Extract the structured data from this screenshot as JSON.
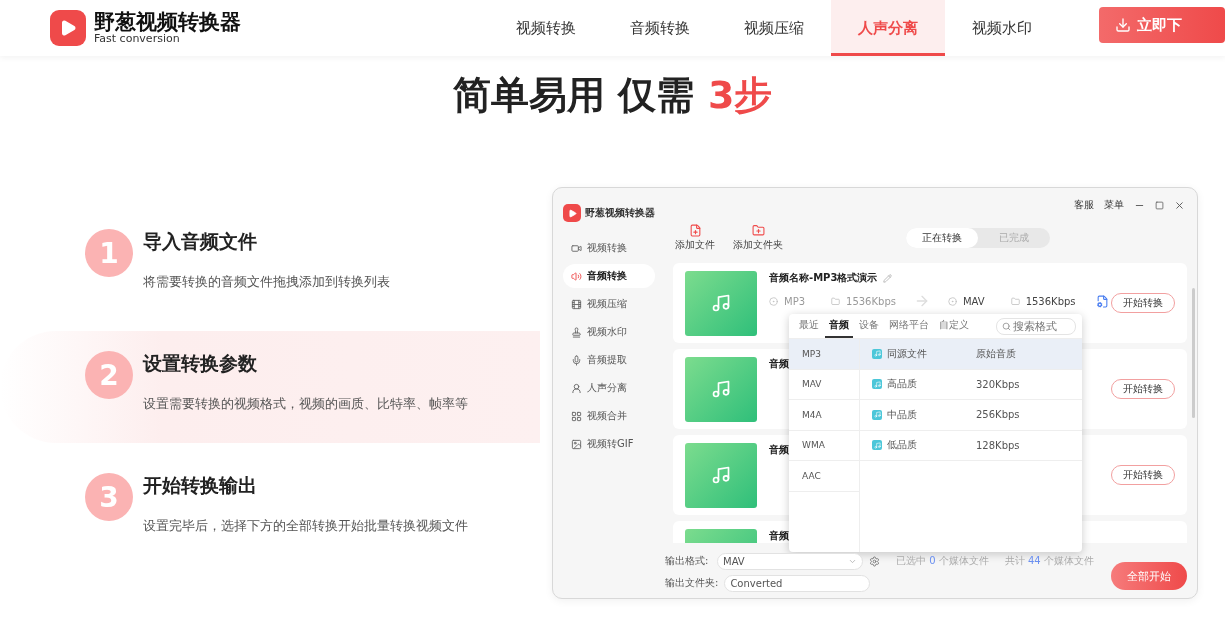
{
  "header": {
    "brand": "野葱视频转换器",
    "tagline": "Fast conversion",
    "download": "立即下",
    "nav": [
      {
        "label": "视频转换",
        "selected": false
      },
      {
        "label": "音频转换",
        "selected": false
      },
      {
        "label": "视频压缩",
        "selected": false
      },
      {
        "label": "人声分离",
        "selected": true
      },
      {
        "label": "视频水印",
        "selected": false
      }
    ]
  },
  "headline": {
    "text": "简单易用 仅需",
    "accent": "3步"
  },
  "steps": [
    {
      "number": "1",
      "title": "导入音频文件",
      "desc": "将需要转换的音频文件拖拽添加到转换列表",
      "selected": false
    },
    {
      "number": "2",
      "title": "设置转换参数",
      "desc": "设置需要转换的视频格式，视频的画质、比特率、帧率等",
      "selected": true
    },
    {
      "number": "3",
      "title": "开始转换输出",
      "desc": "设置完毕后，选择下方的全部转换开始批量转换视频文件",
      "selected": false
    }
  ],
  "app": {
    "brand": "野葱视频转换器",
    "top_links": [
      "客服",
      "菜单"
    ],
    "sidebar": [
      {
        "label": "视频转换",
        "selected": false
      },
      {
        "label": "音频转换",
        "selected": true
      },
      {
        "label": "视频压缩",
        "selected": false
      },
      {
        "label": "视频水印",
        "selected": false
      },
      {
        "label": "音频提取",
        "selected": false
      },
      {
        "label": "人声分离",
        "selected": false
      },
      {
        "label": "视频合并",
        "selected": false
      },
      {
        "label": "视频转GIF",
        "selected": false
      }
    ],
    "toolbar": [
      "添加文件",
      "添加文件夹"
    ],
    "status_tabs": [
      {
        "label": "正在转换",
        "selected": true
      },
      {
        "label": "已完成",
        "selected": false
      }
    ],
    "files": [
      {
        "name": "音频名称-MP3格式演示",
        "format_in": "MP3",
        "bitrate_in": "1536Kbps",
        "format_out": "MAV",
        "bitrate_out": "1536Kbps",
        "action": "开始转换"
      },
      {
        "name": "音频",
        "action": "开始转换"
      },
      {
        "name": "音频",
        "action": "开始转换"
      },
      {
        "name": "音频"
      }
    ],
    "format_menu": {
      "tabs": [
        {
          "label": "最近",
          "selected": false
        },
        {
          "label": "音频",
          "selected": true
        },
        {
          "label": "设备",
          "selected": false
        },
        {
          "label": "网络平台",
          "selected": false
        },
        {
          "label": "自定义",
          "selected": false
        }
      ],
      "search_placeholder": "搜索格式",
      "formats": [
        {
          "label": "MP3",
          "selected": true
        },
        {
          "label": "MAV",
          "selected": false
        },
        {
          "label": "M4A",
          "selected": false
        },
        {
          "label": "WMA",
          "selected": false
        },
        {
          "label": "AAC",
          "selected": false
        }
      ],
      "qualities": [
        {
          "name": "同源文件",
          "bitrate": "原始音质",
          "selected": true
        },
        {
          "name": "高品质",
          "bitrate": "320Kbps",
          "selected": false
        },
        {
          "name": "中品质",
          "bitrate": "256Kbps",
          "selected": false
        },
        {
          "name": "低品质",
          "bitrate": "128Kbps",
          "selected": false
        }
      ]
    },
    "footer": {
      "format_label": "输出格式:",
      "format_value": "MAV",
      "folder_label": "输出文件夹:",
      "folder_value": "Converted",
      "start_all": "全部开始",
      "stats": [
        [
          {
            "text": "已选中 ",
            "kind": "plain"
          },
          {
            "text": "0",
            "kind": "count"
          },
          {
            "text": " 个媒体文件",
            "kind": "plain"
          }
        ],
        [
          {
            "text": "共计 ",
            "kind": "plain"
          },
          {
            "text": "44",
            "kind": "count"
          },
          {
            "text": " 个媒体文件",
            "kind": "plain"
          }
        ]
      ]
    }
  }
}
